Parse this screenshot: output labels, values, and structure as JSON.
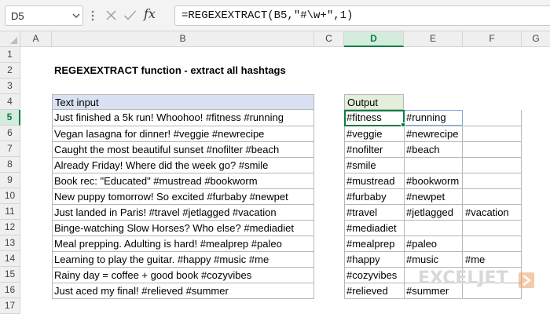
{
  "namebox": {
    "value": "D5"
  },
  "formula": {
    "value": "=REGEXEXTRACT(B5,\"#\\w+\",1)"
  },
  "columns": [
    "A",
    "B",
    "C",
    "D",
    "E",
    "F",
    "G"
  ],
  "rows": [
    "1",
    "2",
    "3",
    "4",
    "5",
    "6",
    "7",
    "8",
    "9",
    "10",
    "11",
    "12",
    "13",
    "14",
    "15",
    "16",
    "17"
  ],
  "selected": {
    "column": "D",
    "row": "5"
  },
  "title": "REGEXEXTRACT function - extract all hashtags",
  "input_header": "Text input",
  "output_header": "Output",
  "inputs": [
    "Just finished a 5k run! Whoohoo! #fitness #running",
    "Vegan lasagna for dinner! #veggie #newrecipe",
    "Caught the most beautiful sunset #nofilter #beach",
    "Already Friday! Where did the week go? #smile",
    "Book rec: \"Educated\" #mustread #bookworm",
    "New puppy tomorrow! So excited #furbaby #newpet",
    "Just landed in Paris! #travel  #jetlagged #vacation",
    "Binge-watching Slow Horses? Who else?  #mediadiet",
    "Meal prepping. Adulting is hard! #mealprep #paleo",
    "Learning to play the guitar. #happy #music #me",
    "Rainy day = coffee + good book #cozyvibes",
    "Just aced my final! #relieved #summer"
  ],
  "outputs": [
    [
      "#fitness",
      "#running",
      ""
    ],
    [
      "#veggie",
      "#newrecipe",
      ""
    ],
    [
      "#nofilter",
      "#beach",
      ""
    ],
    [
      "#smile",
      "",
      ""
    ],
    [
      "#mustread",
      "#bookworm",
      ""
    ],
    [
      "#furbaby",
      "#newpet",
      ""
    ],
    [
      "#travel",
      "#jetlagged",
      "#vacation"
    ],
    [
      "#mediadiet",
      "",
      ""
    ],
    [
      "#mealprep",
      "#paleo",
      ""
    ],
    [
      "#happy",
      "#music",
      "#me"
    ],
    [
      "#cozyvibes",
      "",
      ""
    ],
    [
      "#relieved",
      "#summer",
      ""
    ]
  ],
  "watermark": {
    "text": "EXCELJET"
  },
  "colors": {
    "accent": "#107c41",
    "input_header_fill": "#d9e1f2",
    "output_header_fill": "#e2efda",
    "gridline": "#b7b7b7"
  },
  "icons": [
    "chevron-down-icon",
    "more-options-icon",
    "cancel-icon",
    "enter-checkmark-icon",
    "function-fx-icon",
    "exceljet-logo-icon"
  ]
}
